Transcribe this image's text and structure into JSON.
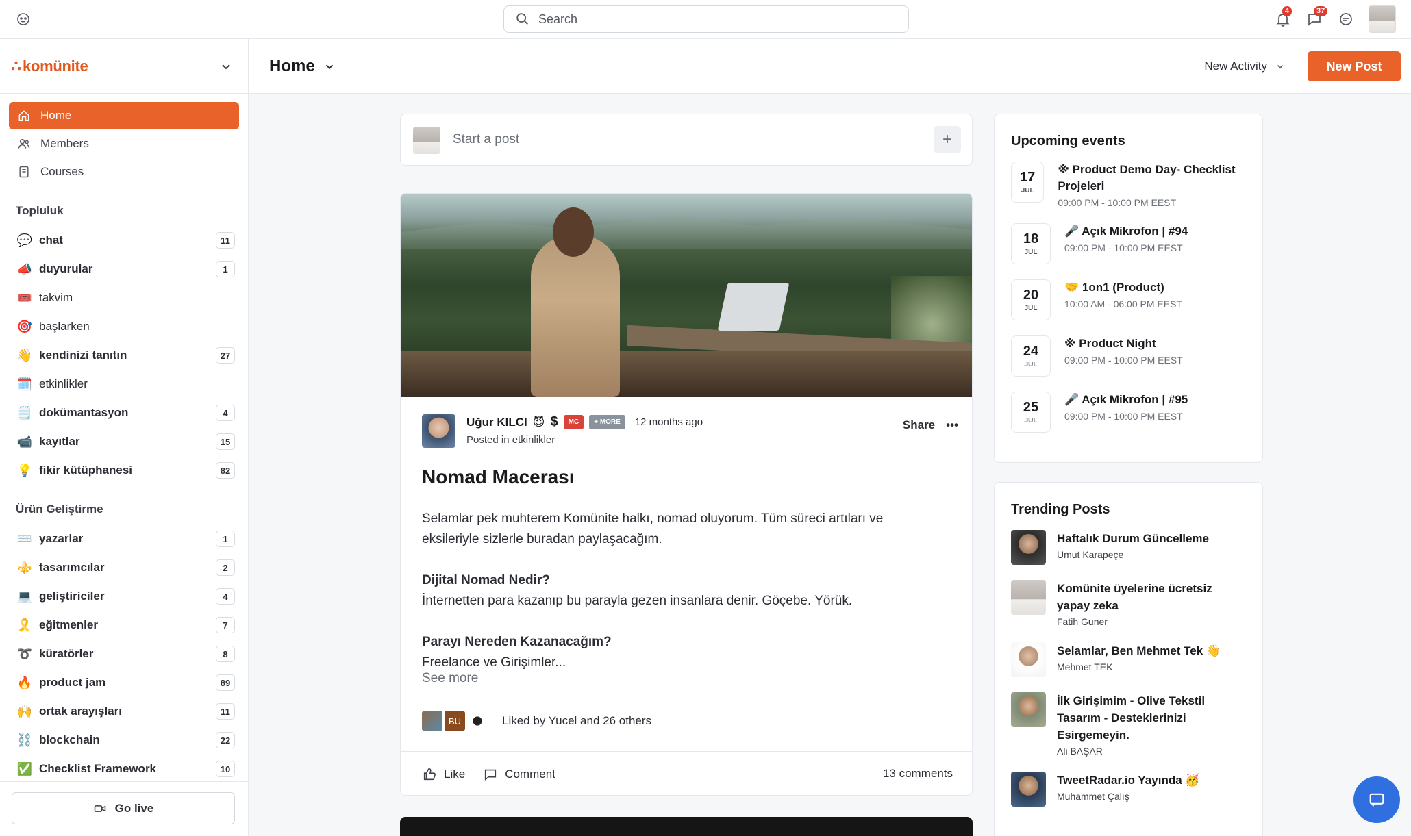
{
  "topbar": {
    "search_placeholder": "Search",
    "notifications_count": "4",
    "messages_count": "37"
  },
  "sidebar": {
    "brand": "komünite",
    "nav": [
      {
        "label": "Home",
        "icon": "home-icon",
        "active": true
      },
      {
        "label": "Members",
        "icon": "members-icon"
      },
      {
        "label": "Courses",
        "icon": "courses-icon"
      }
    ],
    "sections": [
      {
        "title": "Topluluk",
        "channels": [
          {
            "emoji": "💬",
            "name": "chat",
            "count": "11"
          },
          {
            "emoji": "📣",
            "name": "duyurular",
            "count": "1"
          },
          {
            "emoji": "🎟️",
            "name": "takvim",
            "count": ""
          },
          {
            "emoji": "🎯",
            "name": "başlarken",
            "count": ""
          },
          {
            "emoji": "👋",
            "name": "kendinizi tanıtın",
            "count": "27"
          },
          {
            "emoji": "🗓️",
            "name": "etkinlikler",
            "count": ""
          },
          {
            "emoji": "🗒️",
            "name": "dokümantasyon",
            "count": "4"
          },
          {
            "emoji": "📹",
            "name": "kayıtlar",
            "count": "15"
          },
          {
            "emoji": "💡",
            "name": "fikir kütüphanesi",
            "count": "82"
          }
        ]
      },
      {
        "title": "Ürün Geliştirme",
        "channels": [
          {
            "emoji": "⌨️",
            "name": "yazarlar",
            "count": "1"
          },
          {
            "emoji": "⚜️",
            "name": "tasarımcılar",
            "count": "2"
          },
          {
            "emoji": "💻",
            "name": "geliştiriciler",
            "count": "4"
          },
          {
            "emoji": "🎗️",
            "name": "eğitmenler",
            "count": "7"
          },
          {
            "emoji": "➰",
            "name": "küratörler",
            "count": "8"
          },
          {
            "emoji": "🔥",
            "name": "product jam",
            "count": "89"
          },
          {
            "emoji": "🙌",
            "name": "ortak arayışları",
            "count": "11"
          },
          {
            "emoji": "⛓️",
            "name": "blockchain",
            "count": "22"
          },
          {
            "emoji": "✅",
            "name": "Checklist Framework",
            "count": "10"
          }
        ]
      }
    ],
    "go_live": "Go live"
  },
  "header": {
    "title": "Home",
    "new_activity": "New Activity",
    "new_post": "New Post"
  },
  "composer": {
    "placeholder": "Start a post"
  },
  "post": {
    "author": "Uğur KILCI",
    "author_emoji": "😈",
    "dollar": "$",
    "tag_mc": "MC",
    "tag_more": "+ MORE",
    "time": "12 months ago",
    "posted_in": "Posted in etkinlikler",
    "share": "Share",
    "more": "•••",
    "title": "Nomad Macerası",
    "intro": "Selamlar pek muhterem Komünite halkı, nomad oluyorum. Tüm süreci artıları ve eksileriyle sizlerle buradan paylaşacağım.",
    "h1": "Dijital Nomad Nedir?",
    "p1": "İnternetten para kazanıp bu parayla gezen insanlara denir. Göçebe. Yörük.",
    "h2": "Parayı Nereden Kazanacağım?",
    "p2": "Freelance ve Girişimler...",
    "see_more": "See more",
    "liker_initials": "BU",
    "liked_by": "Liked by Yucel and 26 others",
    "like": "Like",
    "comment": "Comment",
    "comments_count": "13 comments"
  },
  "events": {
    "title": "Upcoming events",
    "items": [
      {
        "day": "17",
        "month": "JUL",
        "title": "※ Product Demo Day- Checklist Projeleri",
        "time": "09:00 PM - 10:00 PM EEST"
      },
      {
        "day": "18",
        "month": "JUL",
        "title": "🎤 Açık Mikrofon | #94",
        "time": "09:00 PM - 10:00 PM EEST"
      },
      {
        "day": "20",
        "month": "JUL",
        "title": "🤝 1on1 (Product)",
        "time": "10:00 AM - 06:00 PM EEST"
      },
      {
        "day": "24",
        "month": "JUL",
        "title": "※ Product Night",
        "time": "09:00 PM - 10:00 PM EEST"
      },
      {
        "day": "25",
        "month": "JUL",
        "title": "🎤 Açık Mikrofon | #95",
        "time": "09:00 PM - 10:00 PM EEST"
      }
    ]
  },
  "trending": {
    "title": "Trending Posts",
    "items": [
      {
        "title": "Haftalık Durum Güncelleme",
        "author": "Umut Karapeçe"
      },
      {
        "title": "Komünite üyelerine ücretsiz yapay zeka",
        "author": "Fatih Guner"
      },
      {
        "title": "Selamlar, Ben Mehmet Tek 👋",
        "author": "Mehmet TEK"
      },
      {
        "title": "İlk Girişimim - Olive Tekstil Tasarım - Desteklerinizi Esirgemeyin.",
        "author": "Ali BAŞAR"
      },
      {
        "title": "TweetRadar.io Yayında 🥳",
        "author": "Muhammet Çalış"
      }
    ]
  },
  "colors": {
    "accent": "#e8622a",
    "chat_button": "#2f6fe0"
  }
}
